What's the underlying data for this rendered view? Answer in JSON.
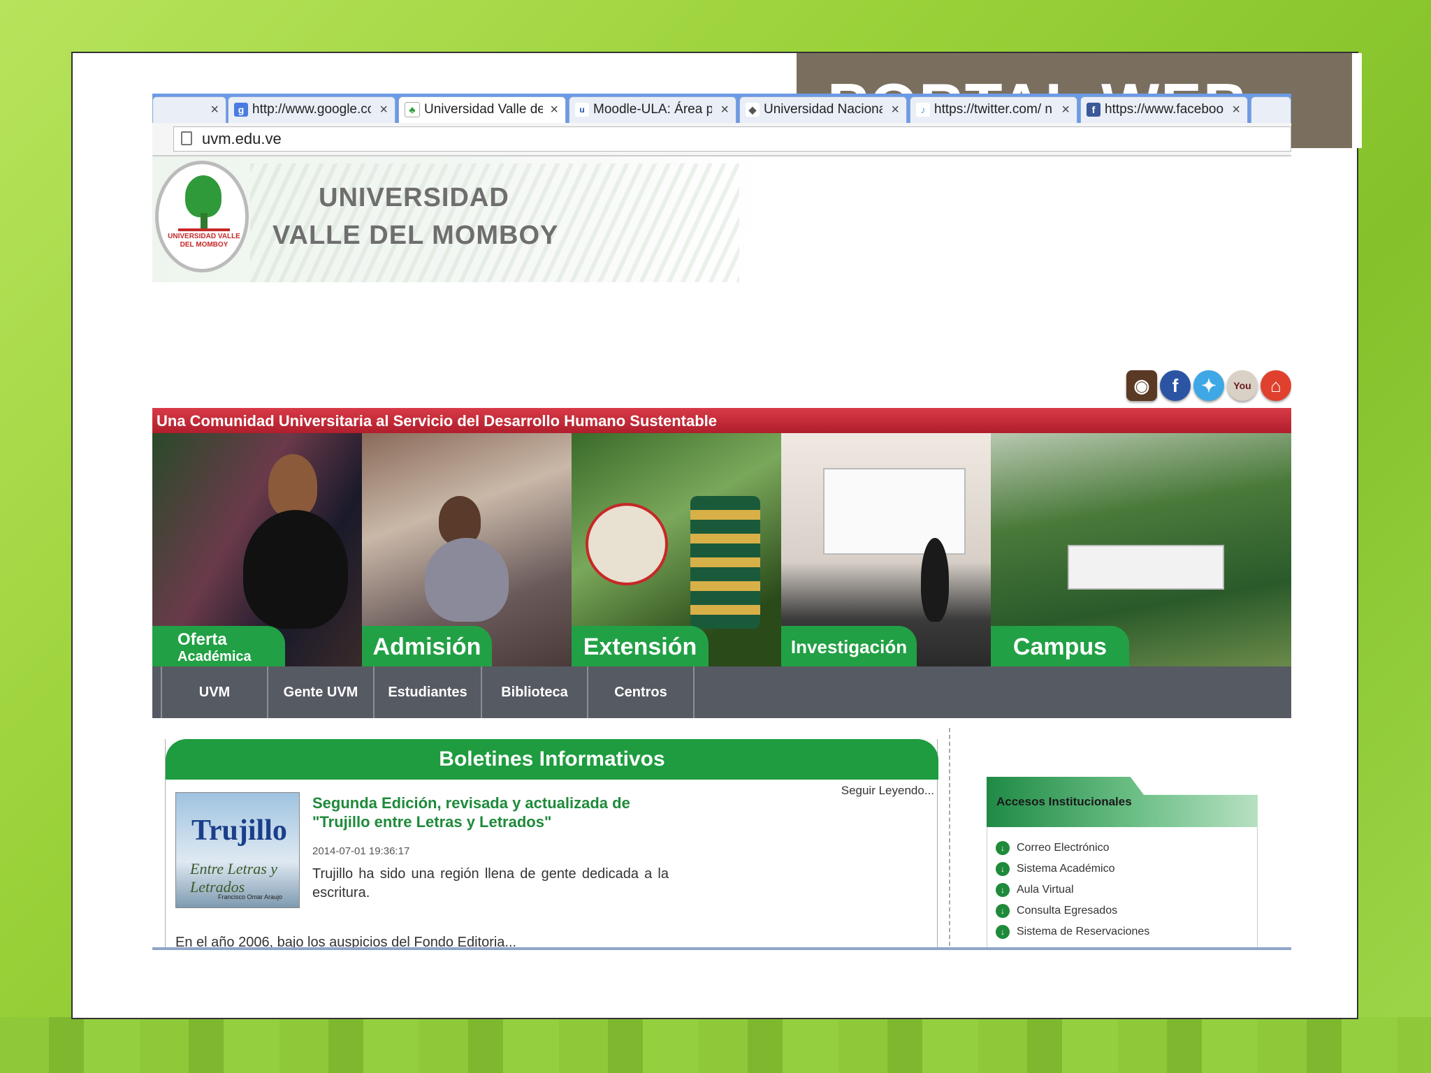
{
  "slide": {
    "title": "PORTAL WEB"
  },
  "browser": {
    "tabs": [
      {
        "title": "",
        "icon": "",
        "active": false
      },
      {
        "title": "http://www.google.co",
        "icon": "google-icon",
        "active": false
      },
      {
        "title": "Universidad Valle del M",
        "icon": "tree-icon",
        "active": true
      },
      {
        "title": "Moodle-ULA: Área per",
        "icon": "moodle-icon",
        "active": false
      },
      {
        "title": "Universidad Nacional E",
        "icon": "una-icon",
        "active": false
      },
      {
        "title": "https://twitter.com/ n",
        "icon": "twitter-icon",
        "active": false
      },
      {
        "title": "https://www.faceboo",
        "icon": "facebook-icon",
        "active": false
      }
    ],
    "url": "uvm.edu.ve"
  },
  "site": {
    "logo_text": "UNIVERSIDAD VALLE DEL MOMBOY",
    "name_line1": "UNIVERSIDAD",
    "name_line2": "VALLE DEL MOMBOY",
    "social": [
      "instagram-icon",
      "facebook-icon",
      "twitter-icon",
      "youtube-icon",
      "home-icon"
    ],
    "tagline": "Una Comunidad Universitaria al Servicio del Desarrollo Humano Sustentable",
    "tiles": [
      {
        "label_line1": "Oferta",
        "label_line2": "Académica"
      },
      {
        "label": "Admisión"
      },
      {
        "label": "Extensión"
      },
      {
        "label": "Investigación"
      },
      {
        "label": "Campus"
      }
    ],
    "nav": [
      "UVM",
      "Gente UVM",
      "Estudiantes",
      "Biblioteca",
      "Centros"
    ],
    "boletines": {
      "heading": "Boletines Informativos",
      "seguir": "Seguir Leyendo...",
      "book_title": "Trujillo",
      "book_subtitle": "Entre Letras y Letrados",
      "book_author": "Francisco Omar Araujo",
      "news_title": "Segunda Edición, revisada y actualizada de \"Trujillo entre Letras y Letrados\"",
      "news_date": "2014-07-01 19:36:17",
      "news_body": "Trujillo ha sido una región llena de gente dedicada a la escritura.",
      "news_more": "En el año 2006, bajo los auspicios del Fondo Editoria..."
    },
    "accesos": {
      "heading": "Accesos Institucionales",
      "items": [
        "Correo Electrónico",
        "Sistema Académico",
        "Aula Virtual",
        "Consulta Egresados",
        "Sistema de Reservaciones"
      ]
    }
  },
  "colors": {
    "brand_green": "#22a045",
    "tagline_red": "#c62833",
    "nav_gray": "#565a63",
    "title_box": "#7a6f5e"
  }
}
